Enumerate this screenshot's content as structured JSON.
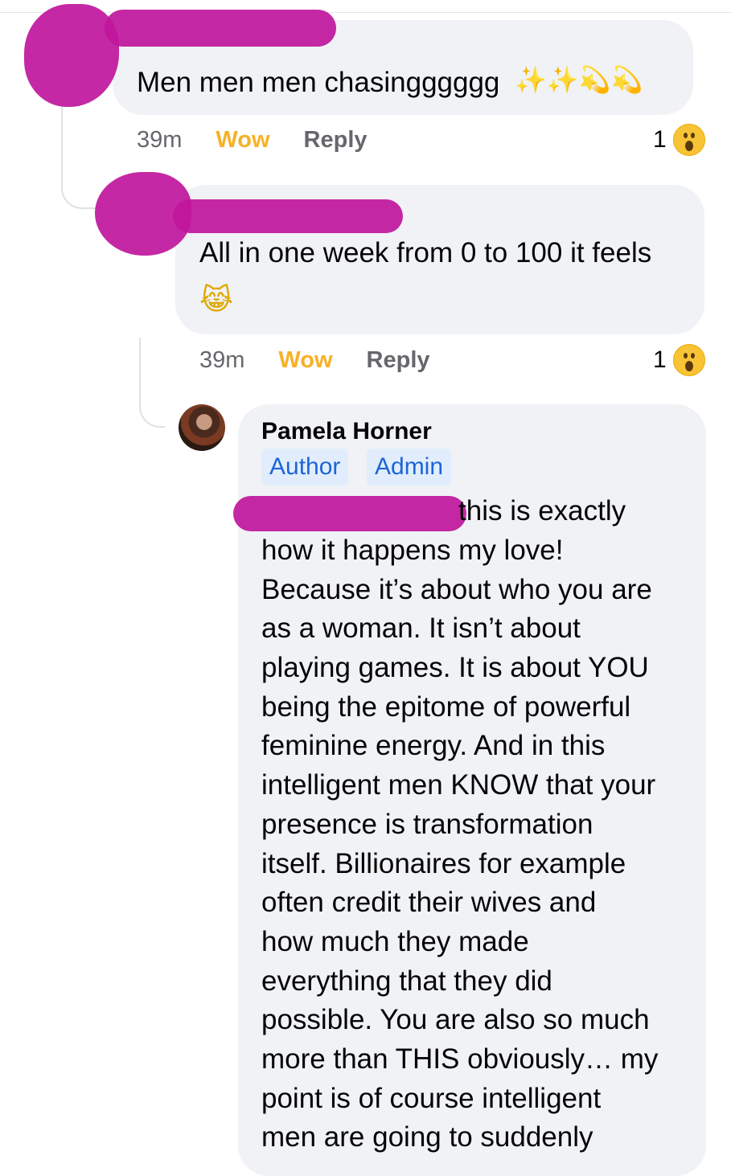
{
  "comments": [
    {
      "text": "Men men men chasingggggg",
      "emoji": "✨✨💫💫",
      "time": "39m",
      "reaction_label": "Wow",
      "reply_label": "Reply",
      "reaction_count": "1"
    },
    {
      "text": "All in one week from 0 to 100 it feels",
      "emoji": "😹",
      "time": "39m",
      "reaction_label": "Wow",
      "reply_label": "Reply",
      "reaction_count": "1"
    }
  ],
  "reply": {
    "author": "Pamela Horner",
    "badges": [
      "Author",
      "Admin"
    ],
    "lines": [
      "this is exactly",
      "how it happens my love!",
      "Because it’s about who you are",
      "as a woman. It isn’t about",
      "playing games. It is about YOU",
      "being the epitome of powerful",
      "feminine energy. And in this",
      "intelligent men KNOW that your",
      "presence is transformation",
      "itself. Billionaires for example",
      "often credit their wives and",
      "how much they made",
      "everything that they did",
      "possible. You are also so much",
      "more than THIS obviously… my",
      "point is of course intelligent",
      "men are going to suddenly"
    ]
  },
  "colors": {
    "bubble": "#f0f2f5",
    "wow": "#f7b125",
    "muted": "#65676b",
    "badge_bg": "#e1edfc",
    "badge_text": "#1c65d8",
    "redaction": "#c0169c"
  },
  "icons": [
    "wow-reaction-icon",
    "avatar"
  ]
}
